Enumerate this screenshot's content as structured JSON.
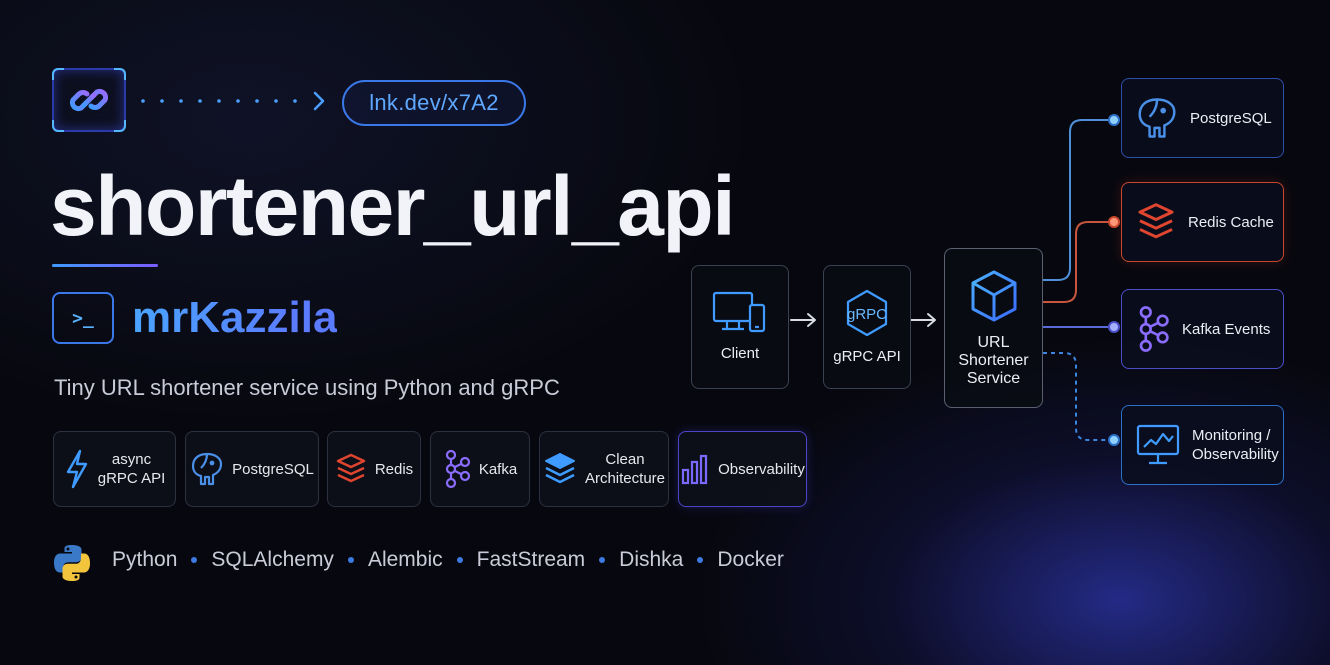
{
  "header": {
    "short_link": "lnk.dev/x7A2",
    "title": "shortener_url_api",
    "author": "mrKazzila",
    "tagline": "Tiny URL shortener service using Python and gRPC"
  },
  "features": [
    {
      "label": "async\ngRPC API",
      "icon": "lightning-icon"
    },
    {
      "label": "PostgreSQL",
      "icon": "postgresql-elephant-icon"
    },
    {
      "label": "Redis",
      "icon": "redis-stack-icon"
    },
    {
      "label": "Kafka",
      "icon": "kafka-nodes-icon"
    },
    {
      "label": "Clean\nArchitecture",
      "icon": "layers-icon"
    },
    {
      "label": "Observability",
      "icon": "bar-chart-icon"
    }
  ],
  "stack": [
    "Python",
    "SQLAlchemy",
    "Alembic",
    "FastStream",
    "Dishka",
    "Docker"
  ],
  "diagram": {
    "client": "Client",
    "grpc_api": "gRPC API",
    "grpc_badge": "gRPC",
    "service": "URL\nShortener\nService",
    "targets": [
      {
        "label": "PostgreSQL",
        "icon": "postgresql-elephant-icon"
      },
      {
        "label": "Redis Cache",
        "icon": "redis-stack-icon"
      },
      {
        "label": "Kafka Events",
        "icon": "kafka-nodes-icon"
      },
      {
        "label": "Monitoring /\nObservability",
        "icon": "monitor-chart-icon"
      }
    ]
  },
  "colors": {
    "accent_blue": "#4aa4ff",
    "accent_violet": "#7b5cff",
    "redis_red": "#e0452f",
    "background": "#07080f"
  }
}
